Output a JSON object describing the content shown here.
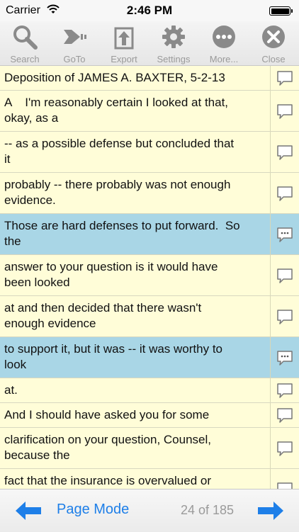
{
  "status_bar": {
    "carrier": "Carrier",
    "time": "2:46 PM"
  },
  "toolbar": {
    "items": [
      {
        "label": "Search",
        "icon": "search-icon"
      },
      {
        "label": "GoTo",
        "icon": "goto-icon"
      },
      {
        "label": "Export",
        "icon": "export-icon"
      },
      {
        "label": "Settings",
        "icon": "gear-icon"
      },
      {
        "label": "More...",
        "icon": "more-icon"
      },
      {
        "label": "Close",
        "icon": "close-icon"
      }
    ],
    "icon_color": "#8a8a8a"
  },
  "transcript": {
    "rows": [
      {
        "text": "Deposition of JAMES A. BAXTER, 5-2-13",
        "highlighted": false,
        "has_note": false
      },
      {
        "text": "A    I'm reasonably certain I looked at that,\nokay, as a",
        "highlighted": false,
        "has_note": false
      },
      {
        "text": "-- as a possible defense but concluded that\nit",
        "highlighted": false,
        "has_note": false
      },
      {
        "text": "probably -- there probably was not enough\nevidence.",
        "highlighted": false,
        "has_note": false
      },
      {
        "text": "Those are hard defenses to put forward.  So\nthe",
        "highlighted": true,
        "has_note": true
      },
      {
        "text": "answer to your question is it would have\nbeen looked",
        "highlighted": false,
        "has_note": false
      },
      {
        "text": "at and then decided that there wasn't\nenough evidence",
        "highlighted": false,
        "has_note": false
      },
      {
        "text": "to support it, but it was -- it was worthy to\nlook",
        "highlighted": true,
        "has_note": true
      },
      {
        "text": "at.",
        "highlighted": false,
        "has_note": false
      },
      {
        "text": "And I should have asked you for some",
        "highlighted": false,
        "has_note": false
      },
      {
        "text": "clarification on your question, Counsel,\nbecause the",
        "highlighted": false,
        "has_note": false
      },
      {
        "text": "fact that the insurance is overvalued or",
        "highlighted": false,
        "has_note": false
      }
    ],
    "colors": {
      "row_bg": "#fffdd8",
      "highlight_bg": "#a9d6e6"
    }
  },
  "bottom_bar": {
    "mode_label": "Page Mode",
    "page_indicator": "24 of 185",
    "accent_color": "#1e7fe8"
  }
}
